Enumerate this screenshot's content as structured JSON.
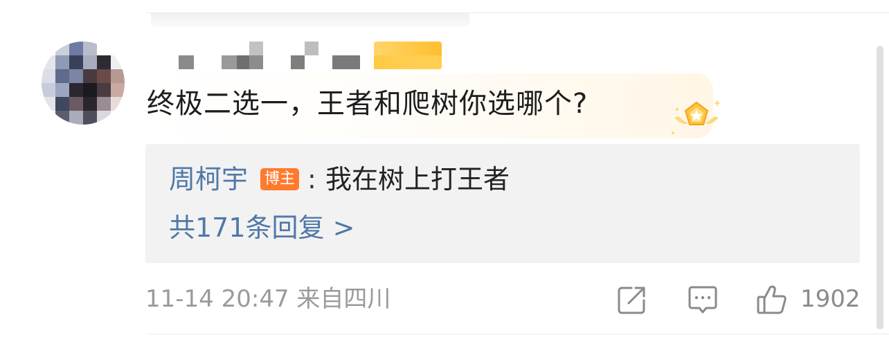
{
  "comment": {
    "text": "终极二选一，王者和爬树你选哪个?",
    "medal_icon": "star-medal-icon"
  },
  "reply": {
    "author": "周柯宇",
    "author_badge": "博主",
    "separator": ":",
    "text": "我在树上打王者",
    "more_replies": "共171条回复 >"
  },
  "meta": {
    "time_location": "11-14 20:47 来自四川"
  },
  "actions": {
    "share_icon": "share-icon",
    "comment_icon": "comment-icon",
    "like_icon": "thumbs-up-icon",
    "like_count": "1902"
  },
  "colors": {
    "link_blue": "#4f78a7",
    "blogger_badge": "#ff7a2e",
    "vip_gold": "#ffc23a",
    "meta_gray": "#9a9a9a"
  }
}
